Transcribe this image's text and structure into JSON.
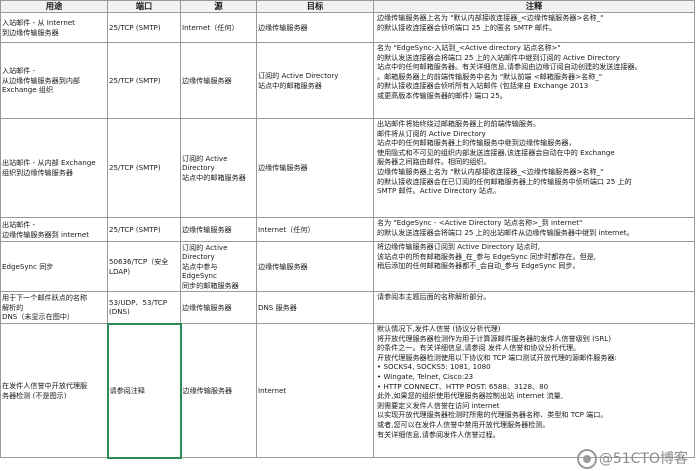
{
  "headers": [
    "用途",
    "端口",
    "源",
    "目标",
    "注释"
  ],
  "rows": [
    {
      "purpose": "入站邮件 - 从 Internet\n到边缘传输服务器",
      "port": "25/TCP (SMTP)",
      "source": "Internet（任何）",
      "target": "边缘传输服务器",
      "note": "边缘传输服务器上名为 \"默认内部接收连接器_<边缘传输服务器>名称_\"\n的默认接收连接器会侦听端口 25 上的匿名 SMTP 邮件。"
    },
    {
      "purpose": "入站邮件 -\n从边缘传输服务器到内部\nExchange 组织",
      "port": "25/TCP (SMTP)",
      "source": "边缘传输服务器",
      "target": "订阅的 Active Directory\n站点中的邮箱服务器",
      "note": "名为 \"EdgeSync-入站到_<Active directory 站点名称>\"\n的默认发送连接器会将端口 25 上的入站邮件中继到订阅的 Active Directory\n站点中的任何邮箱服务器。有关详细信息,请参阅由边缘订阅自动创建的发送连接器。\n。邮箱服务器上的前端传输服务中名为 \"默认前端 <邮箱服务器>名称_\"\n的默认接收连接器会侦听所有入站邮件 (包括来自 Exchange 2013\n或更高版本传输服务器的邮件) 端口 25。"
    },
    {
      "purpose": "出站邮件 - 从内部 Exchange\n组织到边缘传输服务器",
      "port": "25/TCP (SMTP)",
      "source": "订阅的 Active\nDirectory\n站点中的邮箱服务器",
      "target": "边缘传输服务器",
      "note": "出站邮件将始终绕过邮箱服务器上的前端传输服务。\n邮件将从订阅的 Active Directory\n站点中的任何邮箱服务器上的传输服务中继到边缘传输服务器，\n使用隐式和不可见的组织内部发送连接器,该连接器会自动在中的 Exchange\n服务器之间路由邮件。相同的组织。\n边缘传输服务器上名为 \"默认内部接收连接器_<边缘传输服务器>名称_\"\n的默认接收连接器会在已订阅的任何邮箱服务器上的传输服务中侦听端口 25 上的\nSMTP 邮件。Active Directory 站点。"
    },
    {
      "purpose": "出站邮件 -\n边缘传输服务器到 internet",
      "port": "25/TCP (SMTP)",
      "source": "边缘传输服务器",
      "target": "Internet（任何）",
      "note": "名为 \"EdgeSync - <Active Directory 站点名称>_到 internet\"\n的默认发送连接器会将端口 25 上的出站邮件从边缘传输服务器中继到 internet。"
    },
    {
      "purpose": "EdgeSync 同步",
      "port": "50636/TCP（安全\nLDAP)",
      "source": "订阅的 Active\nDirectory\n站点中参与\nEdgeSync\n同步的邮箱服务器",
      "target": "边缘传输服务器",
      "note": "将边缘传输服务器订阅到 Active Directory 站点时,\n该站点中的所有邮箱服务器_在_参与 EdgeSync 同步时都存在。但是,\n稍后添加的任何邮箱服务器都不_会自动_参与 EdgeSync 同步。"
    },
    {
      "purpose": "用于下一个邮件跃点的名称\n解析的\nDNS（未显示在图中）",
      "port": "53/UDP、53/TCP\n(DNS)",
      "source": "边缘传输服务器",
      "target": "DNS 服务器",
      "note": "请参阅本主题后面的名称解析部分。"
    },
    {
      "purpose": "在发件人信誉中开放代理服\n务器检测 (不是图示)",
      "port": "请参阅注释",
      "source": "边缘传输服务器",
      "target": "Internet",
      "note": "默认情况下,发件人信誉 (协议分析代理)\n将开放代理服务器检测作为用于计算源邮件服务器的发件人信誉级别 (SRL)\n的条件之一。有关详细信息,请参阅 发件人信誉和协议分析代理。\n开放代理服务器检测使用以下协议和 TCP 端口测试开放代理的源邮件服务器:\n• SOCKS4, SOCKS5: 1081, 1080\n• Wingate, Telnet, Cisco:23\n• HTTP CONNECT、HTTP POST: 6588、3128、80\n此外,如果您的组织使用代理服务器控制出站 internet 流量,\n则需要定义发件人信誉在访问 internet\n以实现开放代理服务器检测时所需的代理服务器名称、类型和 TCP 端口。\n或者,您可以在发件人信誉中禁用开放代理服务器检测。\n有关详细信息,请参阅发件人信誉过程。"
    }
  ],
  "watermark": {
    "text": "@51CTO博客",
    "icon": "51cto-logo-icon",
    "color": "#8c8c8c"
  },
  "colors": {
    "header_bg": "#f2f2f2",
    "grid": "#9a9a9a",
    "highlight_border": "#2e8b57"
  }
}
